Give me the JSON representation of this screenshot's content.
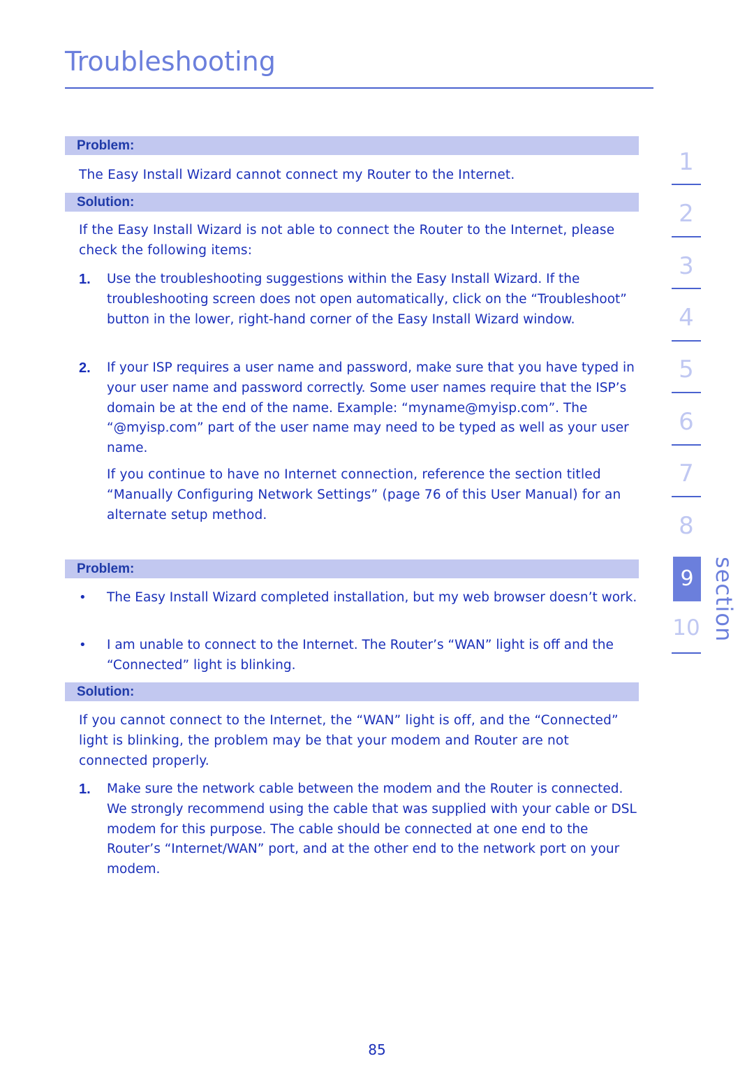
{
  "header": {
    "title": "Troubleshooting"
  },
  "section1": {
    "problem_label": "Problem:",
    "problem_text": "The Easy Install Wizard cannot connect my Router to the Internet.",
    "solution_label": "Solution:",
    "solution_intro": "If the Easy Install Wizard is not able to connect the Router to the Internet, please check the following items:",
    "steps": [
      {
        "num": "1.",
        "text": "Use the troubleshooting suggestions within the Easy Install Wizard. If the troubleshooting screen does not open automatically, click on the “Troubleshoot” button in the lower, right-hand corner of the Easy Install Wizard window."
      },
      {
        "num": "2.",
        "text": "If your ISP requires a user name and password, make sure that you have typed in your user name and password correctly. Some user names require that the ISP’s domain be at the end of the name. Example: “myname@myisp.com”. The “@myisp.com” part of the user name may need to be typed as well as your user name."
      }
    ],
    "followup": "If you continue to have no Internet connection, reference the section titled “Manually Configuring Network Settings” (page 76 of this User Manual) for an alternate setup method."
  },
  "section2": {
    "problem_label": "Problem:",
    "problems": [
      {
        "bullet": "•",
        "text": "The Easy Install Wizard completed installation, but my web browser doesn’t work."
      },
      {
        "bullet": "•",
        "text": "I am unable to connect to the Internet. The Router’s “WAN” light is off and the “Connected” light is blinking."
      }
    ],
    "solution_label": "Solution:",
    "solution_intro": "If you cannot connect to the Internet, the “WAN” light is off, and the “Connected” light is blinking, the problem may be that your modem and Router are not connected properly.",
    "steps": [
      {
        "num": "1.",
        "text": "Make sure the network cable between the modem and the Router is connected. We strongly recommend using the cable that was supplied with your cable or DSL modem for this purpose. The cable should be connected at one end to the Router’s “Internet/WAN” port, and at the other end to the network port on your modem."
      }
    ]
  },
  "section_nav": {
    "label": "section",
    "items": [
      "1",
      "2",
      "3",
      "4",
      "5",
      "6",
      "7",
      "8",
      "9",
      "10"
    ],
    "active": "9"
  },
  "footer": {
    "page_number": "85"
  },
  "colors": {
    "accent": "#6b7fdc",
    "header_bar": "#c2c8f0",
    "text": "#1a2fb8",
    "nav_inactive": "#c0c8f2"
  }
}
